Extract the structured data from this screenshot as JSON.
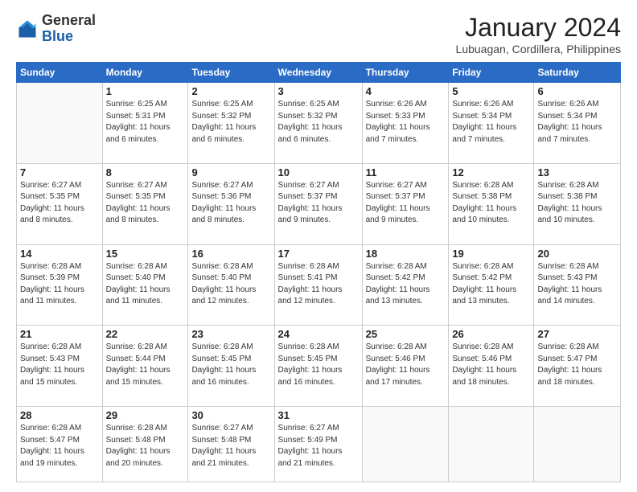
{
  "header": {
    "logo_general": "General",
    "logo_blue": "Blue",
    "month_title": "January 2024",
    "location": "Lubuagan, Cordillera, Philippines"
  },
  "days_of_week": [
    "Sunday",
    "Monday",
    "Tuesday",
    "Wednesday",
    "Thursday",
    "Friday",
    "Saturday"
  ],
  "weeks": [
    [
      {
        "day": "",
        "info": ""
      },
      {
        "day": "1",
        "info": "Sunrise: 6:25 AM\nSunset: 5:31 PM\nDaylight: 11 hours\nand 6 minutes."
      },
      {
        "day": "2",
        "info": "Sunrise: 6:25 AM\nSunset: 5:32 PM\nDaylight: 11 hours\nand 6 minutes."
      },
      {
        "day": "3",
        "info": "Sunrise: 6:25 AM\nSunset: 5:32 PM\nDaylight: 11 hours\nand 6 minutes."
      },
      {
        "day": "4",
        "info": "Sunrise: 6:26 AM\nSunset: 5:33 PM\nDaylight: 11 hours\nand 7 minutes."
      },
      {
        "day": "5",
        "info": "Sunrise: 6:26 AM\nSunset: 5:34 PM\nDaylight: 11 hours\nand 7 minutes."
      },
      {
        "day": "6",
        "info": "Sunrise: 6:26 AM\nSunset: 5:34 PM\nDaylight: 11 hours\nand 7 minutes."
      }
    ],
    [
      {
        "day": "7",
        "info": "Sunrise: 6:27 AM\nSunset: 5:35 PM\nDaylight: 11 hours\nand 8 minutes."
      },
      {
        "day": "8",
        "info": "Sunrise: 6:27 AM\nSunset: 5:35 PM\nDaylight: 11 hours\nand 8 minutes."
      },
      {
        "day": "9",
        "info": "Sunrise: 6:27 AM\nSunset: 5:36 PM\nDaylight: 11 hours\nand 8 minutes."
      },
      {
        "day": "10",
        "info": "Sunrise: 6:27 AM\nSunset: 5:37 PM\nDaylight: 11 hours\nand 9 minutes."
      },
      {
        "day": "11",
        "info": "Sunrise: 6:27 AM\nSunset: 5:37 PM\nDaylight: 11 hours\nand 9 minutes."
      },
      {
        "day": "12",
        "info": "Sunrise: 6:28 AM\nSunset: 5:38 PM\nDaylight: 11 hours\nand 10 minutes."
      },
      {
        "day": "13",
        "info": "Sunrise: 6:28 AM\nSunset: 5:38 PM\nDaylight: 11 hours\nand 10 minutes."
      }
    ],
    [
      {
        "day": "14",
        "info": "Sunrise: 6:28 AM\nSunset: 5:39 PM\nDaylight: 11 hours\nand 11 minutes."
      },
      {
        "day": "15",
        "info": "Sunrise: 6:28 AM\nSunset: 5:40 PM\nDaylight: 11 hours\nand 11 minutes."
      },
      {
        "day": "16",
        "info": "Sunrise: 6:28 AM\nSunset: 5:40 PM\nDaylight: 11 hours\nand 12 minutes."
      },
      {
        "day": "17",
        "info": "Sunrise: 6:28 AM\nSunset: 5:41 PM\nDaylight: 11 hours\nand 12 minutes."
      },
      {
        "day": "18",
        "info": "Sunrise: 6:28 AM\nSunset: 5:42 PM\nDaylight: 11 hours\nand 13 minutes."
      },
      {
        "day": "19",
        "info": "Sunrise: 6:28 AM\nSunset: 5:42 PM\nDaylight: 11 hours\nand 13 minutes."
      },
      {
        "day": "20",
        "info": "Sunrise: 6:28 AM\nSunset: 5:43 PM\nDaylight: 11 hours\nand 14 minutes."
      }
    ],
    [
      {
        "day": "21",
        "info": "Sunrise: 6:28 AM\nSunset: 5:43 PM\nDaylight: 11 hours\nand 15 minutes."
      },
      {
        "day": "22",
        "info": "Sunrise: 6:28 AM\nSunset: 5:44 PM\nDaylight: 11 hours\nand 15 minutes."
      },
      {
        "day": "23",
        "info": "Sunrise: 6:28 AM\nSunset: 5:45 PM\nDaylight: 11 hours\nand 16 minutes."
      },
      {
        "day": "24",
        "info": "Sunrise: 6:28 AM\nSunset: 5:45 PM\nDaylight: 11 hours\nand 16 minutes."
      },
      {
        "day": "25",
        "info": "Sunrise: 6:28 AM\nSunset: 5:46 PM\nDaylight: 11 hours\nand 17 minutes."
      },
      {
        "day": "26",
        "info": "Sunrise: 6:28 AM\nSunset: 5:46 PM\nDaylight: 11 hours\nand 18 minutes."
      },
      {
        "day": "27",
        "info": "Sunrise: 6:28 AM\nSunset: 5:47 PM\nDaylight: 11 hours\nand 18 minutes."
      }
    ],
    [
      {
        "day": "28",
        "info": "Sunrise: 6:28 AM\nSunset: 5:47 PM\nDaylight: 11 hours\nand 19 minutes."
      },
      {
        "day": "29",
        "info": "Sunrise: 6:28 AM\nSunset: 5:48 PM\nDaylight: 11 hours\nand 20 minutes."
      },
      {
        "day": "30",
        "info": "Sunrise: 6:27 AM\nSunset: 5:48 PM\nDaylight: 11 hours\nand 21 minutes."
      },
      {
        "day": "31",
        "info": "Sunrise: 6:27 AM\nSunset: 5:49 PM\nDaylight: 11 hours\nand 21 minutes."
      },
      {
        "day": "",
        "info": ""
      },
      {
        "day": "",
        "info": ""
      },
      {
        "day": "",
        "info": ""
      }
    ]
  ]
}
